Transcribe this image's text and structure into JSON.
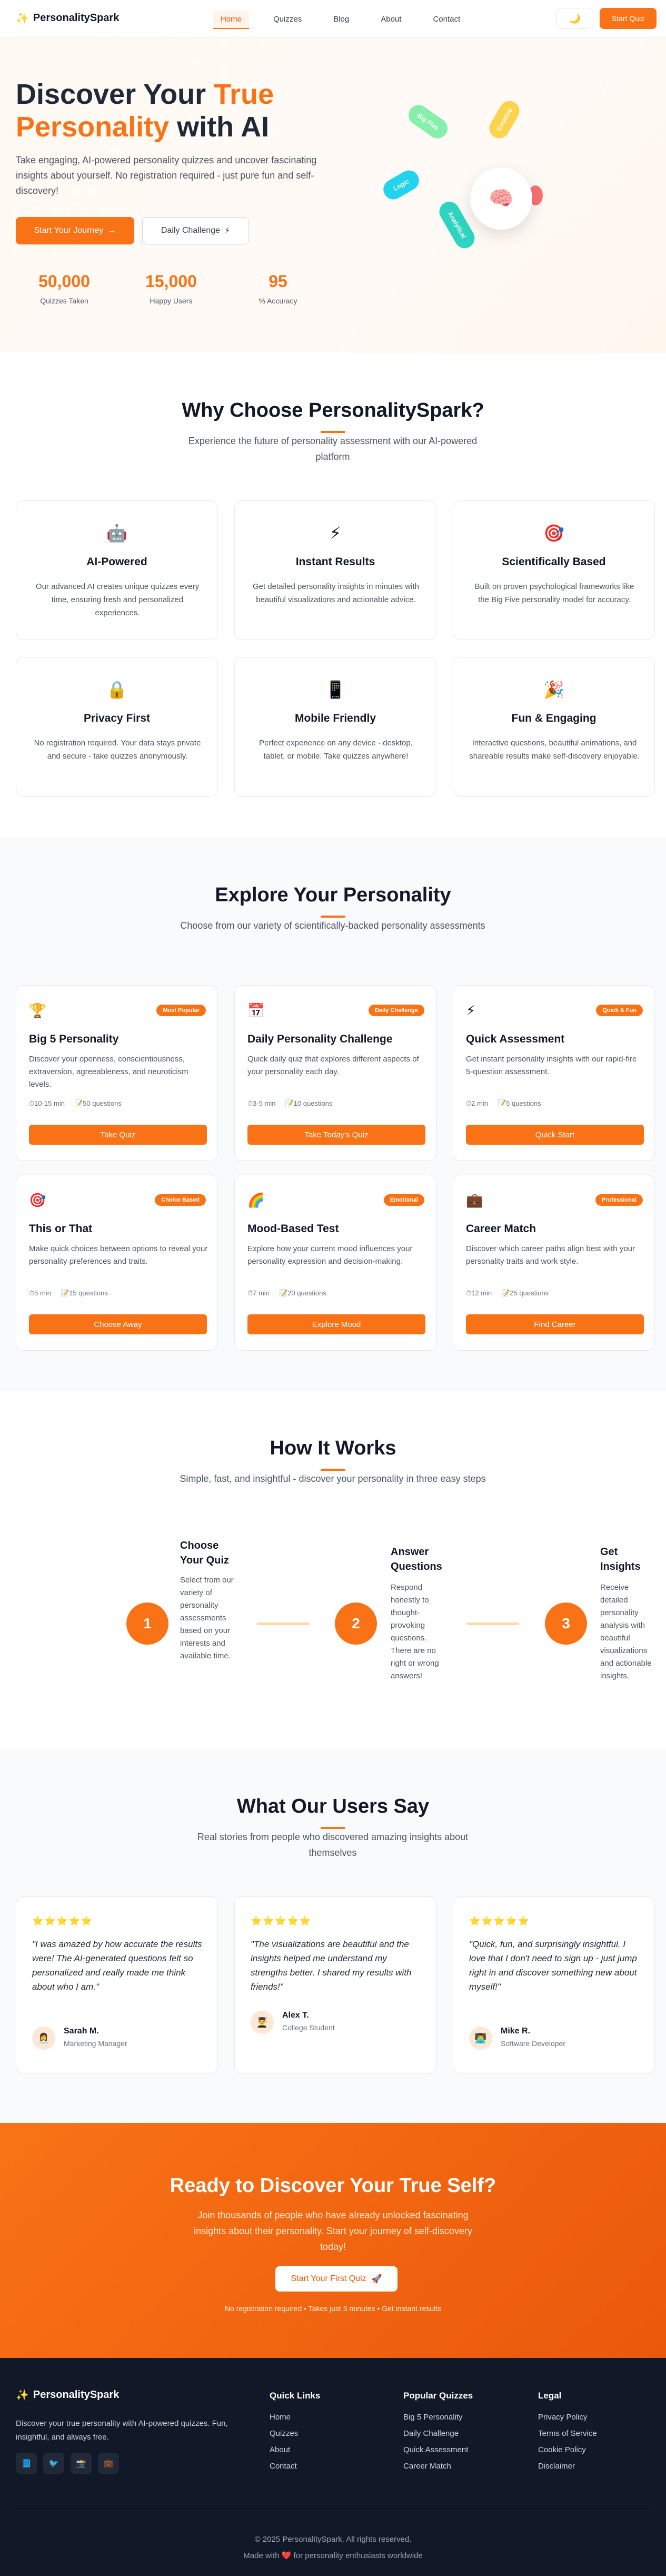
{
  "nav": {
    "brand": "PersonalitySpark",
    "links": [
      "Home",
      "Quizzes",
      "Blog",
      "About",
      "Contact"
    ],
    "mode_icon": "moon-icon",
    "cta": "Start Quiz"
  },
  "hero": {
    "title_a": "Discover Your ",
    "title_b": "True Personality",
    "title_c": " with AI",
    "lede": "Take engaging, AI-powered personality quizzes and uncover fascinating insights about yourself. No registration required - just pure fun and self-discovery!",
    "primary": "Start Your Journey",
    "secondary": "Daily Challenge",
    "stats": [
      {
        "value": "50,000",
        "label": "Quizzes Taken"
      },
      {
        "value": "15,000",
        "label": "Happy Users"
      },
      {
        "value": "95",
        "label": "% Accuracy"
      }
    ],
    "pills": [
      "Big Five",
      "Creative",
      "Logic",
      "Analytical"
    ]
  },
  "why": {
    "title": "Why Choose PersonalitySpark?",
    "subtitle": "Experience the future of personality assessment with our AI-powered platform",
    "features": [
      {
        "icon": "robot-icon",
        "glyph": "🤖",
        "title": "AI-Powered",
        "text": "Our advanced AI creates unique quizzes every time, ensuring fresh and personalized experiences."
      },
      {
        "icon": "lightning-icon",
        "glyph": "⚡",
        "title": "Instant Results",
        "text": "Get detailed personality insights in minutes with beautiful visualizations and actionable advice."
      },
      {
        "icon": "target-icon",
        "glyph": "🎯",
        "title": "Scientifically Based",
        "text": "Built on proven psychological frameworks like the Big Five personality model for accuracy."
      },
      {
        "icon": "lock-icon",
        "glyph": "🔒",
        "title": "Privacy First",
        "text": "No registration required. Your data stays private and secure - take quizzes anonymously."
      },
      {
        "icon": "phone-icon",
        "glyph": "📱",
        "title": "Mobile Friendly",
        "text": "Perfect experience on any device - desktop, tablet, or mobile. Take quizzes anywhere!"
      },
      {
        "icon": "party-icon",
        "glyph": "🎉",
        "title": "Fun & Engaging",
        "text": "Interactive questions, beautiful animations, and shareable results make self-discovery enjoyable."
      }
    ]
  },
  "explore": {
    "title": "Explore Your Personality",
    "subtitle": "Choose from our variety of scientifically-backed personality assessments",
    "quizzes": [
      {
        "icon": "trophy-icon",
        "glyph": "🏆",
        "badge": "Most Popular",
        "title": "Big 5 Personality",
        "text": "Discover your openness, conscientiousness, extraversion, agreeableness, and neuroticism levels.",
        "time": "10-15 min",
        "questions": "50 questions",
        "button": "Take Quiz"
      },
      {
        "icon": "calendar-icon",
        "glyph": "📅",
        "badge": "Daily Challenge",
        "title": "Daily Personality Challenge",
        "text": "Quick daily quiz that explores different aspects of your personality each day.",
        "time": "3-5 min",
        "questions": "10 questions",
        "button": "Take Today's Quiz"
      },
      {
        "icon": "lightning-icon",
        "glyph": "⚡",
        "badge": "Quick & Fun",
        "title": "Quick Assessment",
        "text": "Get instant personality insights with our rapid-fire 5-question assessment.",
        "time": "2 min",
        "questions": "5 questions",
        "button": "Quick Start"
      },
      {
        "icon": "target-icon",
        "glyph": "🎯",
        "badge": "Choice Based",
        "title": "This or That",
        "text": "Make quick choices between options to reveal your personality preferences and traits.",
        "time": "5 min",
        "questions": "15 questions",
        "button": "Choose Away"
      },
      {
        "icon": "rainbow-icon",
        "glyph": "🌈",
        "badge": "Emotional",
        "title": "Mood-Based Test",
        "text": "Explore how your current mood influences your personality expression and decision-making.",
        "time": "7 min",
        "questions": "20 questions",
        "button": "Explore Mood"
      },
      {
        "icon": "briefcase-icon",
        "glyph": "💼",
        "badge": "Professional",
        "title": "Career Match",
        "text": "Discover which career paths align best with your personality traits and work style.",
        "time": "12 min",
        "questions": "25 questions",
        "button": "Find Career"
      }
    ]
  },
  "how": {
    "title": "How It Works",
    "subtitle": "Simple, fast, and insightful - discover your personality in three easy steps",
    "steps": [
      {
        "num": "1",
        "title": "Choose Your Quiz",
        "text": "Select from our variety of personality assessments based on your interests and available time."
      },
      {
        "num": "2",
        "title": "Answer Questions",
        "text": "Respond honestly to thought-provoking questions. There are no right or wrong answers!"
      },
      {
        "num": "3",
        "title": "Get Insights",
        "text": "Receive detailed personality analysis with beautiful visualizations and actionable insights."
      }
    ]
  },
  "testimonials": {
    "title": "What Our Users Say",
    "subtitle": "Real stories from people who discovered amazing insights about themselves",
    "stars": "⭐⭐⭐⭐⭐",
    "items": [
      {
        "quote": "\"I was amazed by how accurate the results were! The AI-generated questions felt so personalized and really made me think about who I am.\"",
        "glyph": "👩‍💼",
        "name": "Sarah M.",
        "role": "Marketing Manager"
      },
      {
        "quote": "\"The visualizations are beautiful and the insights helped me understand my strengths better. I shared my results with friends!\"",
        "glyph": "👨‍🎓",
        "name": "Alex T.",
        "role": "College Student"
      },
      {
        "quote": "\"Quick, fun, and surprisingly insightful. I love that I don't need to sign up - just jump right in and discover something new about myself!\"",
        "glyph": "👨‍💻",
        "name": "Mike R.",
        "role": "Software Developer"
      }
    ]
  },
  "cta": {
    "title": "Ready to Discover Your True Self?",
    "text": "Join thousands of people who have already unlocked fascinating insights about their personality. Start your journey of self-discovery today!",
    "button": "Start Your First Quiz",
    "note": "No registration required • Takes just 5 minutes • Get instant results"
  },
  "footer": {
    "brand": "PersonalitySpark",
    "tagline": "Discover your true personality with AI-powered quizzes. Fun, insightful, and always free.",
    "socials": [
      "facebook-icon",
      "twitter-icon",
      "instagram-icon",
      "linkedin-icon"
    ],
    "cols": [
      {
        "title": "Quick Links",
        "links": [
          "Home",
          "Quizzes",
          "About",
          "Contact"
        ]
      },
      {
        "title": "Popular Quizzes",
        "links": [
          "Big 5 Personality",
          "Daily Challenge",
          "Quick Assessment",
          "Career Match"
        ]
      },
      {
        "title": "Legal",
        "links": [
          "Privacy Policy",
          "Terms of Service",
          "Cookie Policy",
          "Disclaimer"
        ]
      }
    ],
    "copyright": "© 2025 PersonalitySpark. All rights reserved.",
    "made": "Made with ❤️ for personality enthusiasts worldwide"
  },
  "colors": {
    "accent": "#f97316",
    "dark": "#111827"
  }
}
